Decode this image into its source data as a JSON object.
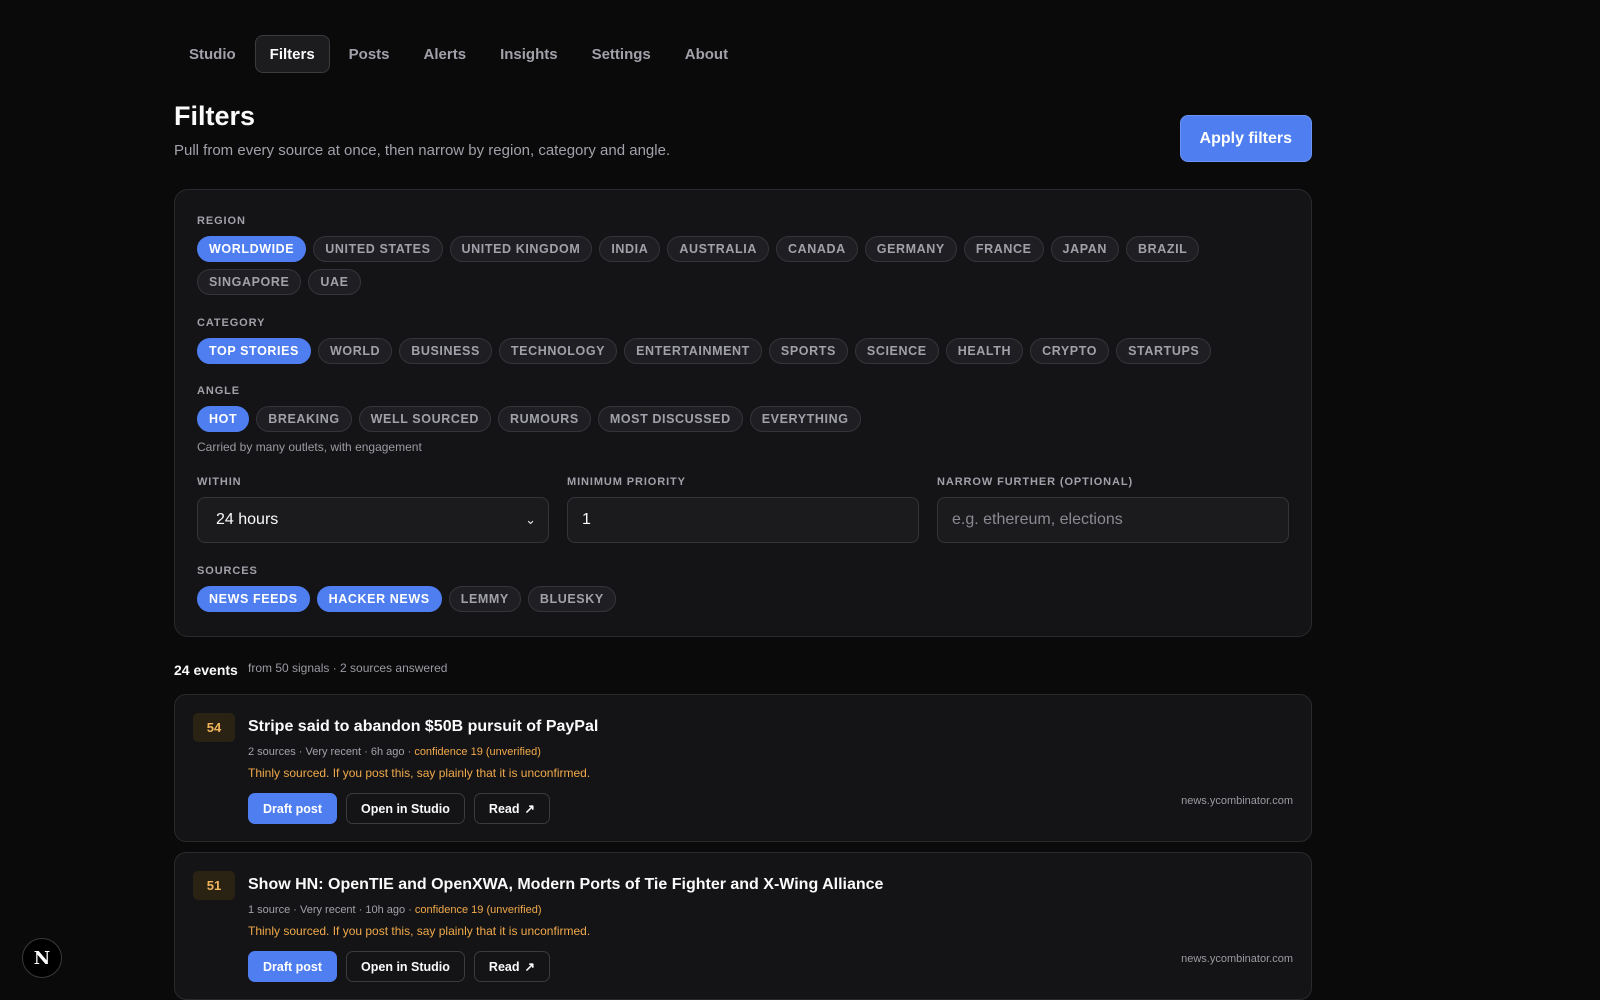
{
  "nav": {
    "tabs": [
      {
        "label": "Studio",
        "active": false
      },
      {
        "label": "Filters",
        "active": true
      },
      {
        "label": "Posts",
        "active": false
      },
      {
        "label": "Alerts",
        "active": false
      },
      {
        "label": "Insights",
        "active": false
      },
      {
        "label": "Settings",
        "active": false
      },
      {
        "label": "About",
        "active": false
      }
    ]
  },
  "header": {
    "title": "Filters",
    "subtitle": "Pull from every source at once, then narrow by region, category and angle.",
    "apply_label": "Apply filters"
  },
  "filters": {
    "region": {
      "label": "REGION",
      "chips": [
        {
          "label": "WORLDWIDE",
          "selected": true
        },
        {
          "label": "UNITED STATES",
          "selected": false
        },
        {
          "label": "UNITED KINGDOM",
          "selected": false
        },
        {
          "label": "INDIA",
          "selected": false
        },
        {
          "label": "AUSTRALIA",
          "selected": false
        },
        {
          "label": "CANADA",
          "selected": false
        },
        {
          "label": "GERMANY",
          "selected": false
        },
        {
          "label": "FRANCE",
          "selected": false
        },
        {
          "label": "JAPAN",
          "selected": false
        },
        {
          "label": "BRAZIL",
          "selected": false
        },
        {
          "label": "SINGAPORE",
          "selected": false
        },
        {
          "label": "UAE",
          "selected": false
        }
      ]
    },
    "category": {
      "label": "CATEGORY",
      "chips": [
        {
          "label": "TOP STORIES",
          "selected": true
        },
        {
          "label": "WORLD",
          "selected": false
        },
        {
          "label": "BUSINESS",
          "selected": false
        },
        {
          "label": "TECHNOLOGY",
          "selected": false
        },
        {
          "label": "ENTERTAINMENT",
          "selected": false
        },
        {
          "label": "SPORTS",
          "selected": false
        },
        {
          "label": "SCIENCE",
          "selected": false
        },
        {
          "label": "HEALTH",
          "selected": false
        },
        {
          "label": "CRYPTO",
          "selected": false
        },
        {
          "label": "STARTUPS",
          "selected": false
        }
      ]
    },
    "angle": {
      "label": "ANGLE",
      "chips": [
        {
          "label": "HOT",
          "selected": true
        },
        {
          "label": "BREAKING",
          "selected": false
        },
        {
          "label": "WELL SOURCED",
          "selected": false
        },
        {
          "label": "RUMOURS",
          "selected": false
        },
        {
          "label": "MOST DISCUSSED",
          "selected": false
        },
        {
          "label": "EVERYTHING",
          "selected": false
        }
      ],
      "note": "Carried by many outlets, with engagement"
    },
    "within": {
      "label": "WITHIN",
      "value": "24 hours"
    },
    "min_priority": {
      "label": "MINIMUM PRIORITY",
      "value": "1"
    },
    "narrow": {
      "label": "NARROW FURTHER (OPTIONAL)",
      "placeholder": "e.g. ethereum, elections",
      "value": ""
    },
    "sources": {
      "label": "SOURCES",
      "chips": [
        {
          "label": "NEWS FEEDS",
          "selected": true
        },
        {
          "label": "HACKER NEWS",
          "selected": true
        },
        {
          "label": "LEMMY",
          "selected": false
        },
        {
          "label": "BLUESKY",
          "selected": false
        }
      ]
    }
  },
  "results": {
    "count": "24 events",
    "meta": "from 50 signals · 2 sources answered",
    "items": [
      {
        "score": "54",
        "title": "Stripe said to abandon $50B pursuit of PayPal",
        "meta": "2 sources · Very recent · 6h ago · ",
        "confidence": "confidence 19 (unverified)",
        "warning": "Thinly sourced. If you post this, say plainly that it is unconfirmed.",
        "draft_label": "Draft post",
        "studio_label": "Open in Studio",
        "read_label": "Read",
        "domain": "news.ycombinator.com"
      },
      {
        "score": "51",
        "title": "Show HN: OpenTIE and OpenXWA, Modern Ports of Tie Fighter and X-Wing Alliance",
        "meta": "1 source · Very recent · 10h ago · ",
        "confidence": "confidence 19 (unverified)",
        "warning": "Thinly sourced. If you post this, say plainly that it is unconfirmed.",
        "draft_label": "Draft post",
        "studio_label": "Open in Studio",
        "read_label": "Read",
        "domain": "news.ycombinator.com"
      }
    ]
  },
  "badge": {
    "label": "N",
    "icon": "nextjs-logo-icon"
  },
  "colors": {
    "accent": "#4f7ef0",
    "warning": "#f0a94a",
    "background": "#0a0a0b"
  }
}
